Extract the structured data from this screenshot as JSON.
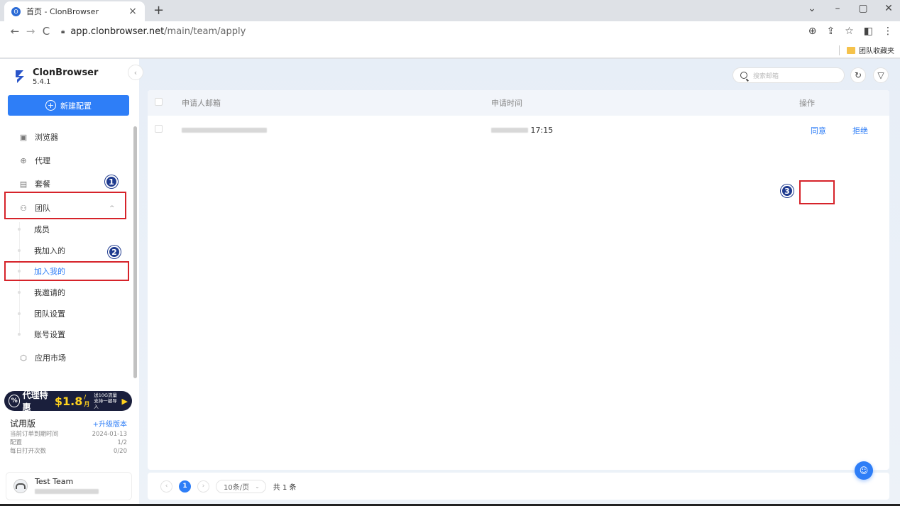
{
  "browser": {
    "tab_title": "首页 - ClonBrowser",
    "tab_favicon": "clonbrowser-favicon",
    "url_host": "app.clonbrowser.net",
    "url_path": "/main/team/apply",
    "bookmark_label": "团队收藏夹"
  },
  "brand": {
    "name": "ClonBrowser",
    "version": "5.4.1"
  },
  "sidebar": {
    "new_config": "新建配置",
    "items": [
      {
        "label": "浏览器",
        "icon": "browser-icon"
      },
      {
        "label": "代理",
        "icon": "globe-icon"
      },
      {
        "label": "套餐",
        "icon": "wallet-icon"
      },
      {
        "label": "团队",
        "icon": "team-icon"
      },
      {
        "label": "应用市场",
        "icon": "cube-icon"
      }
    ],
    "team_sub": [
      "成员",
      "我加入的",
      "加入我的",
      "我邀请的",
      "团队设置",
      "账号设置"
    ],
    "active_sub": "加入我的"
  },
  "promo": {
    "prefix": "代理特惠",
    "price": "$1.8",
    "unit": "/月",
    "line1": "送10G流量",
    "line2": "支持一键导入"
  },
  "plan": {
    "name": "试用版",
    "upgrade": "+升级版本",
    "rows": [
      {
        "label": "当前订单到期时间",
        "value": "2024-01-13"
      },
      {
        "label": "配置",
        "value": "1/2"
      },
      {
        "label": "每日打开次数",
        "value": "0/20"
      }
    ]
  },
  "team_card": {
    "name": "Test Team"
  },
  "search": {
    "placeholder": "搜索邮箱"
  },
  "table": {
    "headers": {
      "email": "申请人邮箱",
      "time": "申请时间",
      "op": "操作"
    },
    "rows": [
      {
        "time": "17:15",
        "accept": "同意",
        "reject": "拒绝"
      }
    ]
  },
  "pager": {
    "current": "1",
    "page_size": "10条/页",
    "total": "共 1 条"
  },
  "annotations": [
    "1",
    "2",
    "3"
  ],
  "colors": {
    "accent": "#2e7ef7",
    "annotation_box": "#d6232a",
    "badge": "#1f3b8f"
  }
}
